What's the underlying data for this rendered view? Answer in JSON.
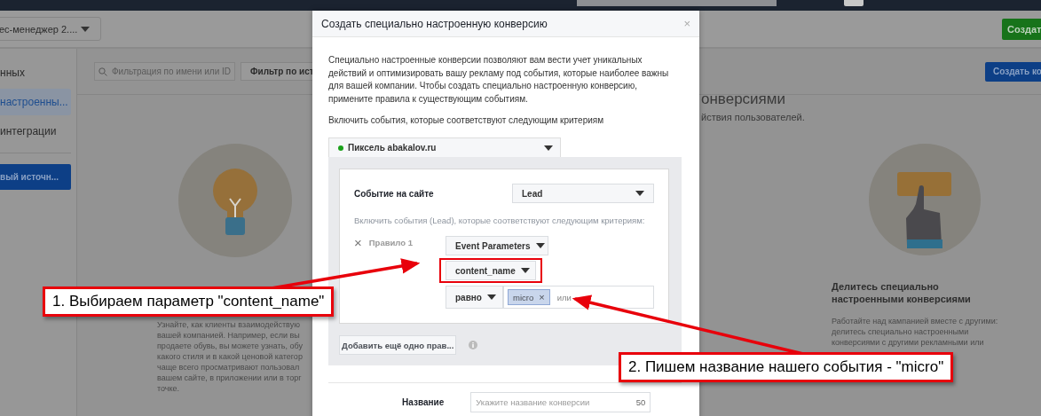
{
  "header": {
    "account": "ес-менеджер 2....",
    "create_button": "Создат"
  },
  "sidebar": {
    "items": [
      {
        "label": "нных",
        "selected": false
      },
      {
        "label": "настроенны...",
        "selected": true
      },
      {
        "label": "интеграции",
        "selected": false
      }
    ],
    "button": "вый источн..."
  },
  "toolbar": {
    "search": {
      "placeholder": "Фильтрация по имени или ID"
    },
    "filter_button": "Фильтр по ист",
    "create_button": "Создать ко"
  },
  "intro": {
    "title": "онверсиями",
    "subtitle": "йствия пользователей."
  },
  "cards": [
    {
      "kind": "bulb",
      "text_lines": [
        "Узнайте, как клиенты взаимодействую",
        "вашей компанией. Например, если вы",
        "продаете обувь, вы можете узнать, обу",
        "какого стиля и в какой ценовой категор",
        "чаще всего просматривают пользовал",
        "вашем сайте, в приложении или в торг",
        "точке."
      ]
    },
    {
      "kind": "hand",
      "title_lines": [
        "Делитесь специально",
        "настроенными конверсиями"
      ],
      "text_lines": [
        "Работайте над кампанией вместе с другими:",
        "делитесь специально настроенными",
        "конверсиями с другими рекламными или"
      ]
    }
  ],
  "modal": {
    "title": "Создать специально настроенную конверсию",
    "close": "×",
    "description": "Специально настроенные конверсии позволяют вам вести учет уникальных действий и оптимизировать вашу рекламу под события, которые наиболее важны для вашей компании. Чтобы создать специально настроенную конверсию, примените правила к существующим событиям.",
    "criteria_label": "Включить события, которые соответствуют следующим критериям",
    "pixel": {
      "label": "Пиксель abakalov.ru",
      "color": "#1aa11a"
    },
    "event": {
      "label": "Событие на сайте",
      "value": "Lead"
    },
    "event_hint": "Включить события (Lead), которые соответствуют следующим критериям:",
    "rule": {
      "remove": "×",
      "label": "Правило 1",
      "dropdowns": [
        {
          "value": "Event Parameters",
          "highlighted": false
        },
        {
          "value": "content_name",
          "highlighted": true
        }
      ],
      "operator": "равно",
      "tokens": [
        {
          "text": "micro",
          "remove": "×"
        }
      ],
      "placeholder": "или"
    },
    "add_rule_button": "Добавить ещё одно прав...",
    "name_field": {
      "label": "Название",
      "placeholder": "Укажите название конверсии",
      "counter": "50"
    }
  },
  "callouts": [
    {
      "text": "1. Выбираем параметр \"content_name\""
    },
    {
      "text": "2. Пишем название нашего события - \"micro\""
    }
  ]
}
